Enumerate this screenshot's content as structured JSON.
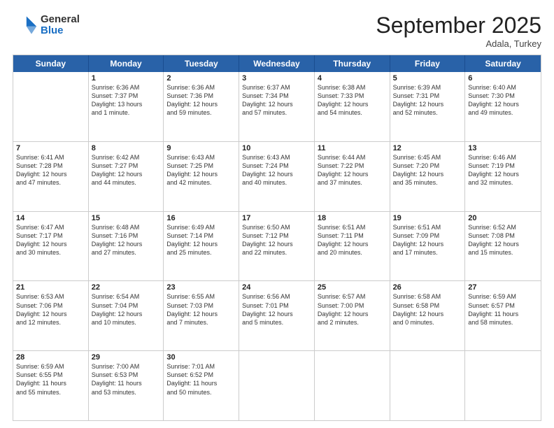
{
  "logo": {
    "general": "General",
    "blue": "Blue"
  },
  "title": "September 2025",
  "location": "Adala, Turkey",
  "weekdays": [
    "Sunday",
    "Monday",
    "Tuesday",
    "Wednesday",
    "Thursday",
    "Friday",
    "Saturday"
  ],
  "weeks": [
    [
      {
        "day": "",
        "lines": []
      },
      {
        "day": "1",
        "lines": [
          "Sunrise: 6:36 AM",
          "Sunset: 7:37 PM",
          "Daylight: 13 hours",
          "and 1 minute."
        ]
      },
      {
        "day": "2",
        "lines": [
          "Sunrise: 6:36 AM",
          "Sunset: 7:36 PM",
          "Daylight: 12 hours",
          "and 59 minutes."
        ]
      },
      {
        "day": "3",
        "lines": [
          "Sunrise: 6:37 AM",
          "Sunset: 7:34 PM",
          "Daylight: 12 hours",
          "and 57 minutes."
        ]
      },
      {
        "day": "4",
        "lines": [
          "Sunrise: 6:38 AM",
          "Sunset: 7:33 PM",
          "Daylight: 12 hours",
          "and 54 minutes."
        ]
      },
      {
        "day": "5",
        "lines": [
          "Sunrise: 6:39 AM",
          "Sunset: 7:31 PM",
          "Daylight: 12 hours",
          "and 52 minutes."
        ]
      },
      {
        "day": "6",
        "lines": [
          "Sunrise: 6:40 AM",
          "Sunset: 7:30 PM",
          "Daylight: 12 hours",
          "and 49 minutes."
        ]
      }
    ],
    [
      {
        "day": "7",
        "lines": [
          "Sunrise: 6:41 AM",
          "Sunset: 7:28 PM",
          "Daylight: 12 hours",
          "and 47 minutes."
        ]
      },
      {
        "day": "8",
        "lines": [
          "Sunrise: 6:42 AM",
          "Sunset: 7:27 PM",
          "Daylight: 12 hours",
          "and 44 minutes."
        ]
      },
      {
        "day": "9",
        "lines": [
          "Sunrise: 6:43 AM",
          "Sunset: 7:25 PM",
          "Daylight: 12 hours",
          "and 42 minutes."
        ]
      },
      {
        "day": "10",
        "lines": [
          "Sunrise: 6:43 AM",
          "Sunset: 7:24 PM",
          "Daylight: 12 hours",
          "and 40 minutes."
        ]
      },
      {
        "day": "11",
        "lines": [
          "Sunrise: 6:44 AM",
          "Sunset: 7:22 PM",
          "Daylight: 12 hours",
          "and 37 minutes."
        ]
      },
      {
        "day": "12",
        "lines": [
          "Sunrise: 6:45 AM",
          "Sunset: 7:20 PM",
          "Daylight: 12 hours",
          "and 35 minutes."
        ]
      },
      {
        "day": "13",
        "lines": [
          "Sunrise: 6:46 AM",
          "Sunset: 7:19 PM",
          "Daylight: 12 hours",
          "and 32 minutes."
        ]
      }
    ],
    [
      {
        "day": "14",
        "lines": [
          "Sunrise: 6:47 AM",
          "Sunset: 7:17 PM",
          "Daylight: 12 hours",
          "and 30 minutes."
        ]
      },
      {
        "day": "15",
        "lines": [
          "Sunrise: 6:48 AM",
          "Sunset: 7:16 PM",
          "Daylight: 12 hours",
          "and 27 minutes."
        ]
      },
      {
        "day": "16",
        "lines": [
          "Sunrise: 6:49 AM",
          "Sunset: 7:14 PM",
          "Daylight: 12 hours",
          "and 25 minutes."
        ]
      },
      {
        "day": "17",
        "lines": [
          "Sunrise: 6:50 AM",
          "Sunset: 7:12 PM",
          "Daylight: 12 hours",
          "and 22 minutes."
        ]
      },
      {
        "day": "18",
        "lines": [
          "Sunrise: 6:51 AM",
          "Sunset: 7:11 PM",
          "Daylight: 12 hours",
          "and 20 minutes."
        ]
      },
      {
        "day": "19",
        "lines": [
          "Sunrise: 6:51 AM",
          "Sunset: 7:09 PM",
          "Daylight: 12 hours",
          "and 17 minutes."
        ]
      },
      {
        "day": "20",
        "lines": [
          "Sunrise: 6:52 AM",
          "Sunset: 7:08 PM",
          "Daylight: 12 hours",
          "and 15 minutes."
        ]
      }
    ],
    [
      {
        "day": "21",
        "lines": [
          "Sunrise: 6:53 AM",
          "Sunset: 7:06 PM",
          "Daylight: 12 hours",
          "and 12 minutes."
        ]
      },
      {
        "day": "22",
        "lines": [
          "Sunrise: 6:54 AM",
          "Sunset: 7:04 PM",
          "Daylight: 12 hours",
          "and 10 minutes."
        ]
      },
      {
        "day": "23",
        "lines": [
          "Sunrise: 6:55 AM",
          "Sunset: 7:03 PM",
          "Daylight: 12 hours",
          "and 7 minutes."
        ]
      },
      {
        "day": "24",
        "lines": [
          "Sunrise: 6:56 AM",
          "Sunset: 7:01 PM",
          "Daylight: 12 hours",
          "and 5 minutes."
        ]
      },
      {
        "day": "25",
        "lines": [
          "Sunrise: 6:57 AM",
          "Sunset: 7:00 PM",
          "Daylight: 12 hours",
          "and 2 minutes."
        ]
      },
      {
        "day": "26",
        "lines": [
          "Sunrise: 6:58 AM",
          "Sunset: 6:58 PM",
          "Daylight: 12 hours",
          "and 0 minutes."
        ]
      },
      {
        "day": "27",
        "lines": [
          "Sunrise: 6:59 AM",
          "Sunset: 6:57 PM",
          "Daylight: 11 hours",
          "and 58 minutes."
        ]
      }
    ],
    [
      {
        "day": "28",
        "lines": [
          "Sunrise: 6:59 AM",
          "Sunset: 6:55 PM",
          "Daylight: 11 hours",
          "and 55 minutes."
        ]
      },
      {
        "day": "29",
        "lines": [
          "Sunrise: 7:00 AM",
          "Sunset: 6:53 PM",
          "Daylight: 11 hours",
          "and 53 minutes."
        ]
      },
      {
        "day": "30",
        "lines": [
          "Sunrise: 7:01 AM",
          "Sunset: 6:52 PM",
          "Daylight: 11 hours",
          "and 50 minutes."
        ]
      },
      {
        "day": "",
        "lines": []
      },
      {
        "day": "",
        "lines": []
      },
      {
        "day": "",
        "lines": []
      },
      {
        "day": "",
        "lines": []
      }
    ]
  ]
}
